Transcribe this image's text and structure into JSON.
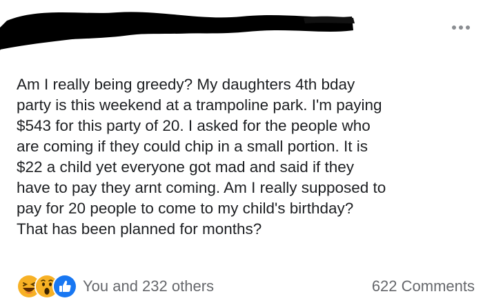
{
  "post": {
    "text_lines": [
      "Am I really being greedy? My daughters 4th bday",
      "party is this weekend at a trampoline park. I'm paying",
      "$543 for this party of 20. I asked for the people who",
      "are coming if they could chip in a small portion. It is",
      "$22 a child yet everyone got mad and said if they",
      "have to pay they arnt coming. Am I really supposed to",
      "pay for 20 people to come to my child's birthday?",
      "That has been planned for months?"
    ],
    "more_icon": "more-horizontal-icon"
  },
  "footer": {
    "reactions": [
      "haha-reaction-icon",
      "wow-reaction-icon",
      "like-reaction-icon"
    ],
    "reactions_text": "You and 232 others",
    "comments_text": "622 Comments"
  },
  "colors": {
    "text": "#1c1e21",
    "meta_text": "#65676b",
    "like_blue": "#1877f2",
    "reaction_yellow": "#f7b125",
    "redaction": "#000000"
  }
}
